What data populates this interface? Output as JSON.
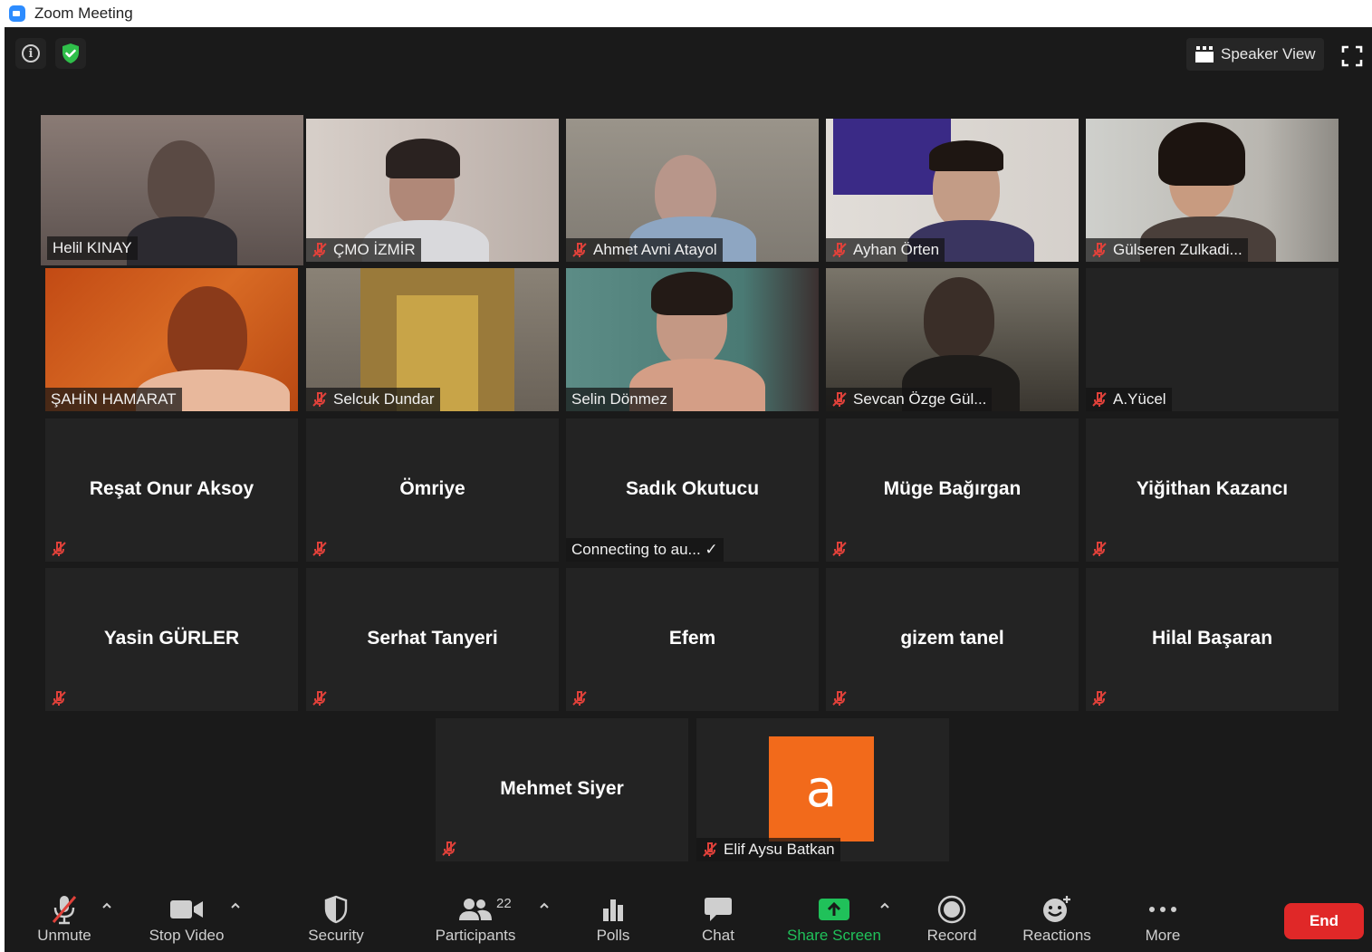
{
  "window": {
    "title": "Zoom Meeting"
  },
  "top_bar": {
    "view_label": "Speaker View"
  },
  "participants_grid": [
    {
      "name": "Helil KINAY",
      "muted": false,
      "video": true
    },
    {
      "name": "ÇMO İZMİR",
      "muted": true,
      "video": true
    },
    {
      "name": "Ahmet Avni Atayol",
      "muted": true,
      "video": true
    },
    {
      "name": "Ayhan Örten",
      "muted": true,
      "video": true
    },
    {
      "name": "Gülseren Zulkadi...",
      "muted": true,
      "video": true
    },
    {
      "name": "ŞAHİN HAMARAT",
      "muted": false,
      "video": true
    },
    {
      "name": "Selcuk Dundar",
      "muted": true,
      "video": true
    },
    {
      "name": "Selin Dönmez",
      "muted": false,
      "video": true
    },
    {
      "name": "Sevcan Özge Gül...",
      "muted": true,
      "video": true
    },
    {
      "name": "A.Yücel",
      "muted": true,
      "video": false
    },
    {
      "name": "Reşat Onur Aksoy",
      "muted": true,
      "video": false
    },
    {
      "name": "Ömriye",
      "muted": true,
      "video": false
    },
    {
      "name": "Sadık Okutucu",
      "muted": false,
      "video": false,
      "status": "Connecting to au... ✓"
    },
    {
      "name": "Müge Bağırgan",
      "muted": true,
      "video": false
    },
    {
      "name": "Yiğithan Kazancı",
      "muted": true,
      "video": false
    },
    {
      "name": "Yasin GÜRLER",
      "muted": true,
      "video": false
    },
    {
      "name": "Serhat Tanyeri",
      "muted": true,
      "video": false
    },
    {
      "name": "Efem",
      "muted": true,
      "video": false
    },
    {
      "name": "gizem tanel",
      "muted": true,
      "video": false
    },
    {
      "name": "Hilal Başaran",
      "muted": true,
      "video": false
    },
    {
      "name": "Mehmet Siyer",
      "muted": true,
      "video": false
    },
    {
      "name": "Elif Aysu Batkan",
      "muted": true,
      "video": false,
      "avatar_letter": "a",
      "avatar_color": "#f26a1b"
    }
  ],
  "toolbar": {
    "unmute": "Unmute",
    "stop_video": "Stop Video",
    "security": "Security",
    "participants": "Participants",
    "participants_count": "22",
    "polls": "Polls",
    "chat": "Chat",
    "share_screen": "Share Screen",
    "record": "Record",
    "reactions": "Reactions",
    "more": "More",
    "end": "End"
  },
  "colors": {
    "background": "#1a1a1a",
    "tile": "#232323",
    "active_speaker_border": "#c9f07a",
    "muted_red": "#e0413a",
    "share_green": "#20c15a",
    "end_red": "#e02828"
  }
}
